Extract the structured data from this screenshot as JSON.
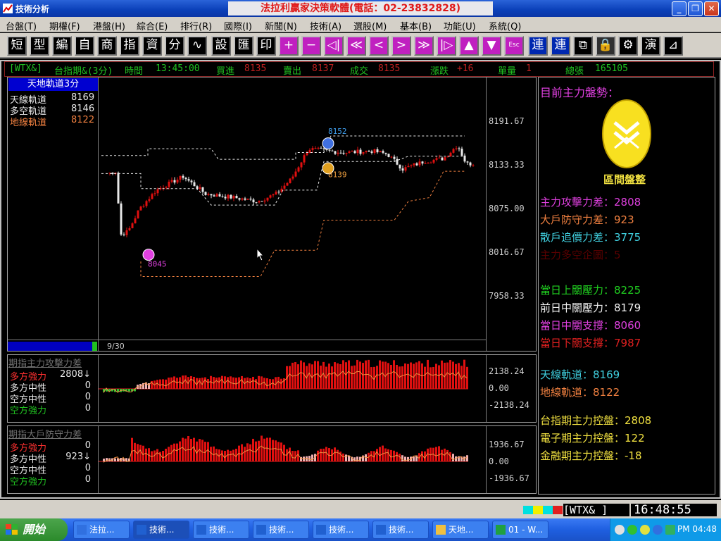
{
  "window": {
    "title": "技術分析",
    "ad_banner": "法拉利贏家決策軟體(電話：02-23832828)"
  },
  "menu": [
    "台盤(T)",
    "期權(F)",
    "港盤(H)",
    "綜合(E)",
    "排行(R)",
    "國際(I)",
    "新聞(N)",
    "技術(A)",
    "選股(M)",
    "基本(B)",
    "功能(U)",
    "系統(Q)"
  ],
  "toolbar": [
    "短",
    "型",
    "編",
    "自",
    "商",
    "指",
    "資",
    "分",
    "∿",
    "設",
    "匯",
    "印",
    "+",
    "−",
    "◁|",
    "≪",
    "<",
    ">",
    "≫",
    "|▷",
    "▲",
    "▼",
    "Esc",
    "連",
    "連",
    "⧉",
    "🔒",
    "⚙",
    "演",
    "⊿"
  ],
  "quote": {
    "code": "[WTX&]",
    "name": "台指期&(3分)",
    "time_label": "時間",
    "time": "13:45:00",
    "bid_label": "買進",
    "bid": "8135",
    "ask_label": "賣出",
    "ask": "8137",
    "trade_label": "成交",
    "trade": "8135",
    "change_label": "漲跌",
    "change": "+16",
    "volume_label": "單量",
    "volume": "1",
    "total_label": "總張",
    "total": "165105"
  },
  "main_chart": {
    "legend_title": "天地軌道3分",
    "legend": [
      {
        "label": "天線軌道",
        "value": "8169",
        "color": "#e8e8e8"
      },
      {
        "label": "多空軌道",
        "value": "8146",
        "color": "#e8e8e8"
      },
      {
        "label": "地線軌道",
        "value": "8122",
        "color": "#f08040"
      }
    ],
    "y_ticks": [
      "8191.67",
      "8133.33",
      "8075.00",
      "8016.67",
      "7958.33"
    ],
    "date_label": "9/30",
    "annotations": {
      "high": "8152",
      "mid": "8139",
      "low": "8045"
    }
  },
  "attack_chart": {
    "title": "期指主力攻擊力差",
    "rows": [
      {
        "label": "多方強力",
        "value": "2808↓",
        "color": "#ff3030"
      },
      {
        "label": "多方中性",
        "value": "0",
        "color": "#e8e8e8"
      },
      {
        "label": "空方中性",
        "value": "0",
        "color": "#e8e8e8"
      },
      {
        "label": "空方強力",
        "value": "0",
        "color": "#20c020"
      }
    ],
    "y_ticks": [
      "2138.24",
      "0.00",
      "-2138.24"
    ]
  },
  "defense_chart": {
    "title": "期指大戶防守力差",
    "rows": [
      {
        "label": "多方強力",
        "value": "0",
        "color": "#ff3030"
      },
      {
        "label": "多方中性",
        "value": "923↓",
        "color": "#e8e8e8"
      },
      {
        "label": "空方中性",
        "value": "0",
        "color": "#e8e8e8"
      },
      {
        "label": "空方強力",
        "value": "0",
        "color": "#20c020"
      }
    ],
    "y_ticks": [
      "1936.67",
      "0.00",
      "-1936.67"
    ]
  },
  "side": {
    "heading": "目前主力盤勢：",
    "badge_label": "區間盤整",
    "lines": [
      {
        "text": "主力攻擊力差：2808",
        "color": "#e040e0"
      },
      {
        "text": "大戶防守力差：923",
        "color": "#f08040"
      },
      {
        "text": "散戶追價力差：3775",
        "color": "#40d0e0"
      },
      {
        "text": "主力多空企圖：5",
        "color": "#5a0000"
      },
      {
        "text": "當日上關壓力：8225",
        "color": "#20d020"
      },
      {
        "text": "前日中關壓力：8179",
        "color": "#f0f0f0"
      },
      {
        "text": "當日中關支撐：8060",
        "color": "#e040e0"
      },
      {
        "text": "當日下關支撐：7987",
        "color": "#e02020"
      },
      {
        "text": "天線軌道：8169",
        "color": "#40d0e0"
      },
      {
        "text": "地線軌道：8122",
        "color": "#f08040"
      },
      {
        "text": "台指期主力控盤：2808",
        "color": "#f0e040"
      },
      {
        "text": "電子期主力控盤：122",
        "color": "#f0e040"
      },
      {
        "text": "金融期主力控盤：-18",
        "color": "#f0e040"
      }
    ]
  },
  "status": {
    "code": "[WTX&   ]",
    "clock": "16:48:55"
  },
  "taskbar": {
    "start_label": "開始",
    "tasks": [
      "法拉...",
      "技術...",
      "技術...",
      "技術...",
      "技術...",
      "技術...",
      "天地...",
      "01 - W..."
    ],
    "tray_clock": "PM 04:48"
  },
  "colors": {
    "bull": "#e01010",
    "bear": "#e8e8e8",
    "top_band": "#e8e8e8",
    "bottom_band": "#f08040"
  }
}
